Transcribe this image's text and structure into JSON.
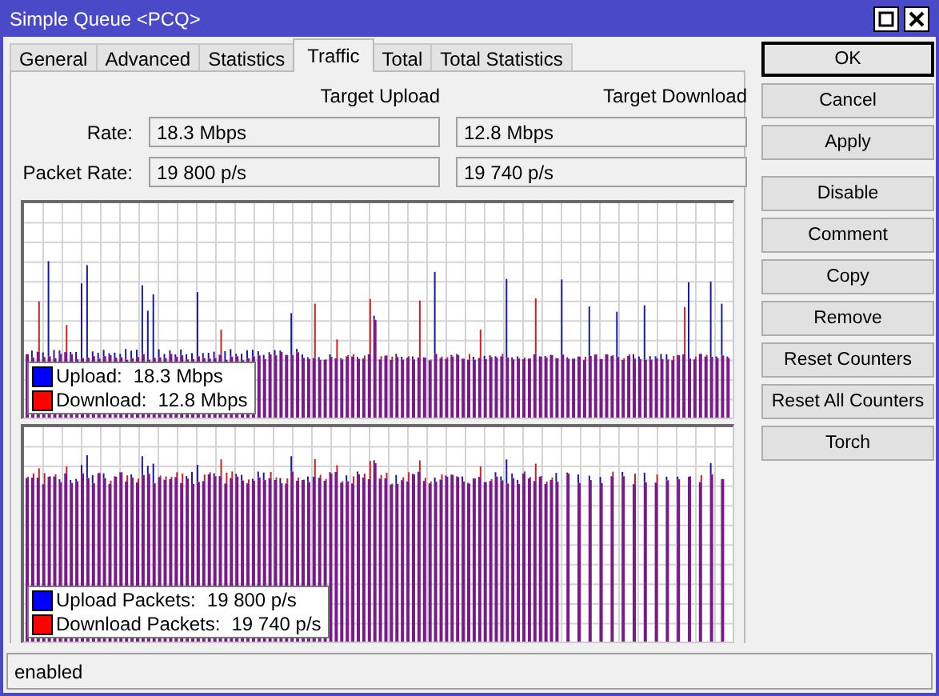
{
  "window": {
    "title": "Simple Queue <PCQ>"
  },
  "tabs": [
    {
      "label": "General",
      "selected": false
    },
    {
      "label": "Advanced",
      "selected": false
    },
    {
      "label": "Statistics",
      "selected": false
    },
    {
      "label": "Traffic",
      "selected": true
    },
    {
      "label": "Total",
      "selected": false
    },
    {
      "label": "Total Statistics",
      "selected": false
    }
  ],
  "columns": [
    "Target Upload",
    "Target Download"
  ],
  "rows": [
    {
      "label": "Rate:",
      "values": [
        "18.3 Mbps",
        "12.8 Mbps"
      ]
    },
    {
      "label": "Packet Rate:",
      "values": [
        "19 800 p/s",
        "19 740 p/s"
      ]
    }
  ],
  "graphs": [
    {
      "kind": "rate",
      "legend": [
        {
          "label": "Upload:",
          "value": "18.3 Mbps",
          "color": "#0000ff"
        },
        {
          "label": "Download:",
          "value": "12.8 Mbps",
          "color": "#ff0000"
        }
      ]
    },
    {
      "kind": "packets",
      "legend": [
        {
          "label": "Upload Packets:",
          "value": "19 800 p/s",
          "color": "#0000ff"
        },
        {
          "label": "Download Packets:",
          "value": "19 740 p/s",
          "color": "#ff0000"
        }
      ]
    }
  ],
  "button_groups": [
    [
      {
        "label": "OK",
        "default": true
      },
      {
        "label": "Cancel",
        "default": false
      },
      {
        "label": "Apply",
        "default": false
      }
    ],
    [
      {
        "label": "Disable",
        "default": false
      },
      {
        "label": "Comment",
        "default": false
      },
      {
        "label": "Copy",
        "default": false
      },
      {
        "label": "Remove",
        "default": false
      },
      {
        "label": "Reset Counters",
        "default": false
      },
      {
        "label": "Reset All Counters",
        "default": false
      },
      {
        "label": "Torch",
        "default": false
      }
    ]
  ],
  "status_bar": "enabled"
}
